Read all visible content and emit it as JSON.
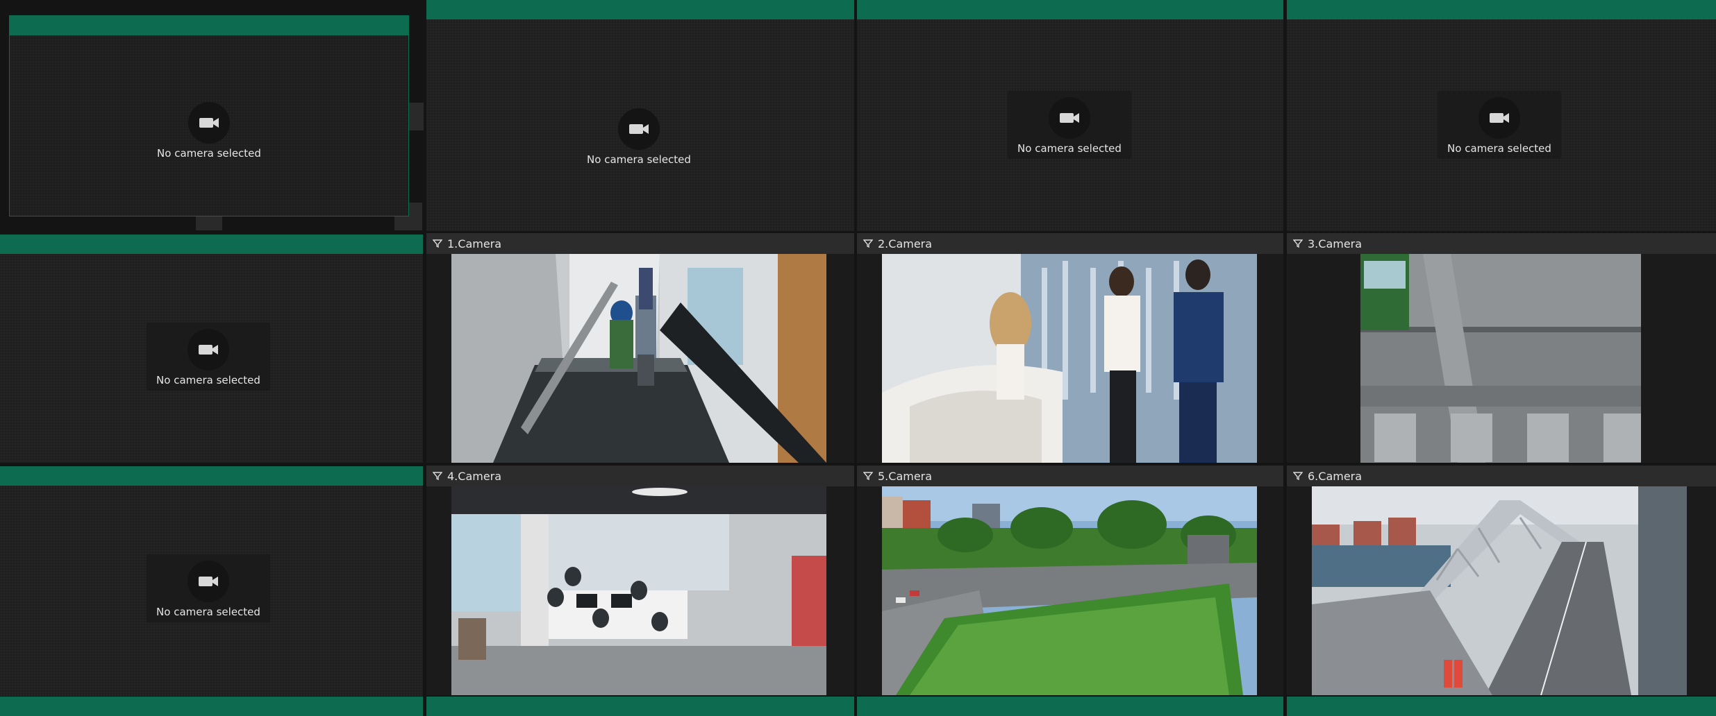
{
  "placeholder_text": "No camera selected",
  "cameras": [
    {
      "label": "1.Camera"
    },
    {
      "label": "2.Camera"
    },
    {
      "label": "3.Camera"
    },
    {
      "label": "4.Camera"
    },
    {
      "label": "5.Camera"
    },
    {
      "label": "6.Camera"
    }
  ],
  "colors": {
    "accent": "#0d6b50",
    "tile_bg": "#202020",
    "header_bg": "#2c2c2c"
  },
  "icons": {
    "placeholder": "video-camera-icon",
    "header": "filter-funnel-icon"
  }
}
